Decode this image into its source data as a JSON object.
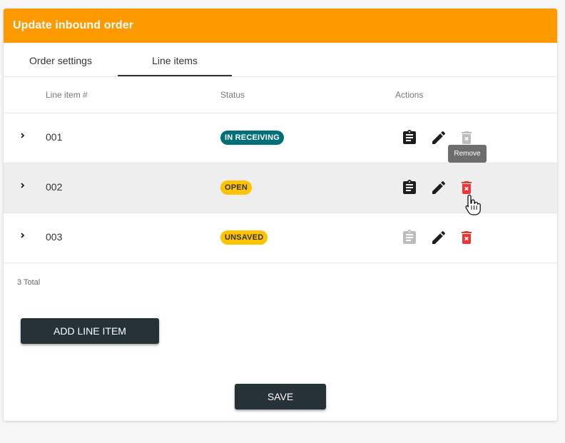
{
  "dialog": {
    "title": "Update inbound order"
  },
  "tabs": [
    {
      "label": "Order settings",
      "active": false
    },
    {
      "label": "Line items",
      "active": true
    }
  ],
  "table": {
    "columns": [
      "",
      "Line item #",
      "Status",
      "Actions"
    ],
    "rows": [
      {
        "line_item": "001",
        "status": "IN RECEIVING",
        "status_color": "#006f7a",
        "details_enabled": true,
        "remove_enabled": false
      },
      {
        "line_item": "002",
        "status": "OPEN",
        "status_color": "#ffc300",
        "details_enabled": true,
        "remove_enabled": true,
        "hovered": true
      },
      {
        "line_item": "003",
        "status": "UNSAVED",
        "status_color": "#ffc300",
        "details_enabled": false,
        "remove_enabled": true
      }
    ],
    "total_label": "3 Total"
  },
  "tooltip": {
    "text": "Remove"
  },
  "buttons": {
    "add_line_item": "ADD LINE ITEM",
    "save": "SAVE"
  },
  "icons": {
    "expand": "chevron-right-icon",
    "details": "clipboard-icon",
    "edit": "pencil-icon",
    "remove": "trash-icon",
    "cursor": "hand-pointer-icon"
  },
  "colors": {
    "header": "#ff9900",
    "button": "#263238",
    "danger": "#e53935",
    "disabled": "#bdbdbd",
    "teal_badge": "#006f7a",
    "yellow_badge": "#ffc300"
  }
}
